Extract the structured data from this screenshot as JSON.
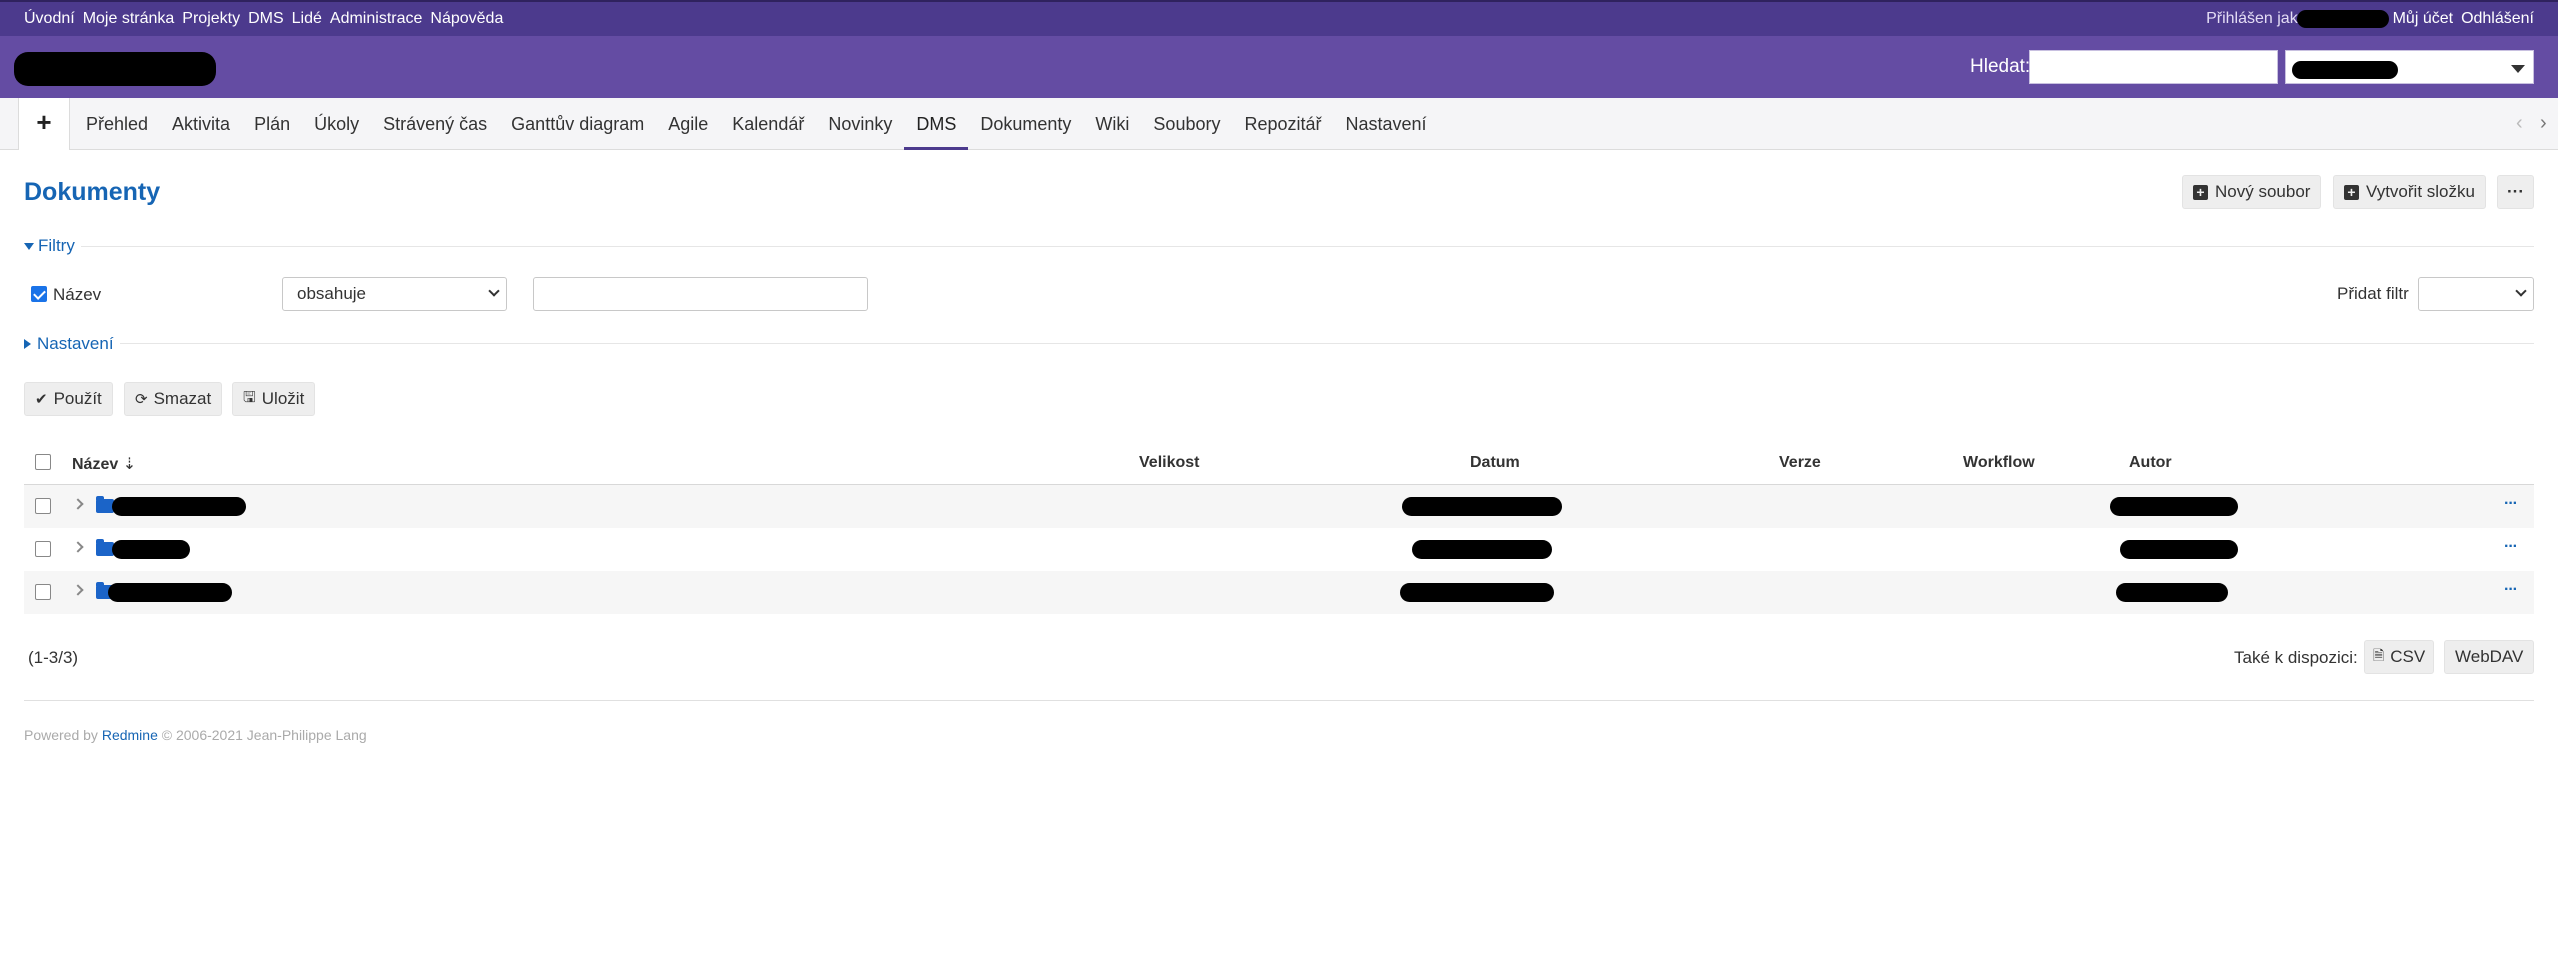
{
  "top_menu": {
    "items": [
      "Úvodní",
      "Moje stránka",
      "Projekty",
      "DMS",
      "Lidé",
      "Administrace",
      "Nápověda"
    ],
    "logged_in_as": "Přihlášen jako",
    "my_account": "Můj účet",
    "logout": "Odhlášení"
  },
  "header": {
    "search_label": "Hledat:"
  },
  "main_menu": {
    "new_item": "+",
    "tabs": [
      "Přehled",
      "Aktivita",
      "Plán",
      "Úkoly",
      "Strávený čas",
      "Ganttův diagram",
      "Agile",
      "Kalendář",
      "Novinky",
      "DMS",
      "Dokumenty",
      "Wiki",
      "Soubory",
      "Repozitář",
      "Nastavení"
    ],
    "selected_tab": "DMS"
  },
  "page": {
    "title": "Dokumenty",
    "buttons": {
      "new_file": "Nový soubor",
      "create_folder": "Vytvořit složku",
      "more": "···"
    }
  },
  "filters": {
    "legend": "Filtry",
    "field_label": "Název",
    "operator": "obsahuje",
    "add_filter_label": "Přidat filtr"
  },
  "options": {
    "legend": "Nastavení"
  },
  "actions": {
    "apply": "Použít",
    "clear": "Smazat",
    "save": "Uložit"
  },
  "table": {
    "columns": {
      "name": "Název",
      "size": "Velikost",
      "date": "Datum",
      "version": "Verze",
      "workflow": "Workflow",
      "author": "Autor"
    },
    "row_menu": "···"
  },
  "pagination": {
    "count": "(1-3/3)",
    "also_available": "Také k dispozici:",
    "csv": "CSV",
    "webdav": "WebDAV"
  },
  "footer": {
    "powered_by": "Powered by",
    "redmine": "Redmine",
    "copyright": "© 2006-2021 Jean-Philippe Lang"
  },
  "colors": {
    "top_bar": "#4c3a8d",
    "header": "#644ca3",
    "link": "#1665b4"
  }
}
